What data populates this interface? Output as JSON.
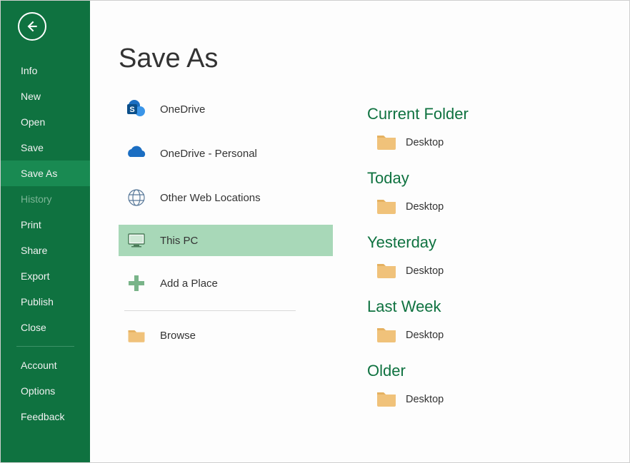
{
  "page_title": "Save As",
  "sidebar": {
    "items": [
      {
        "label": "Info",
        "state": "normal"
      },
      {
        "label": "New",
        "state": "normal"
      },
      {
        "label": "Open",
        "state": "normal"
      },
      {
        "label": "Save",
        "state": "normal"
      },
      {
        "label": "Save As",
        "state": "selected"
      },
      {
        "label": "History",
        "state": "disabled"
      },
      {
        "label": "Print",
        "state": "normal"
      },
      {
        "label": "Share",
        "state": "normal"
      },
      {
        "label": "Export",
        "state": "normal"
      },
      {
        "label": "Publish",
        "state": "normal"
      },
      {
        "label": "Close",
        "state": "normal"
      }
    ],
    "footer_items": [
      {
        "label": "Account"
      },
      {
        "label": "Options"
      },
      {
        "label": "Feedback"
      }
    ]
  },
  "locations": [
    {
      "label": "OneDrive",
      "icon": "sharepoint"
    },
    {
      "label": "OneDrive - Personal",
      "icon": "onedrive"
    },
    {
      "label": "Other Web Locations",
      "icon": "web"
    },
    {
      "label": "This PC",
      "icon": "pc",
      "selected": true
    },
    {
      "label": "Add a Place",
      "icon": "plus"
    },
    {
      "label": "Browse",
      "icon": "folder"
    }
  ],
  "recent": [
    {
      "heading": "Current Folder",
      "folders": [
        {
          "name": "Desktop"
        }
      ]
    },
    {
      "heading": "Today",
      "folders": [
        {
          "name": "Desktop"
        }
      ]
    },
    {
      "heading": "Yesterday",
      "folders": [
        {
          "name": "Desktop"
        }
      ]
    },
    {
      "heading": "Last Week",
      "folders": [
        {
          "name": "Desktop"
        }
      ]
    },
    {
      "heading": "Older",
      "folders": [
        {
          "name": "Desktop"
        }
      ]
    }
  ],
  "window_controls": {
    "help": "?",
    "minimize": "minimize",
    "maximize": "maximize",
    "close": "close"
  }
}
